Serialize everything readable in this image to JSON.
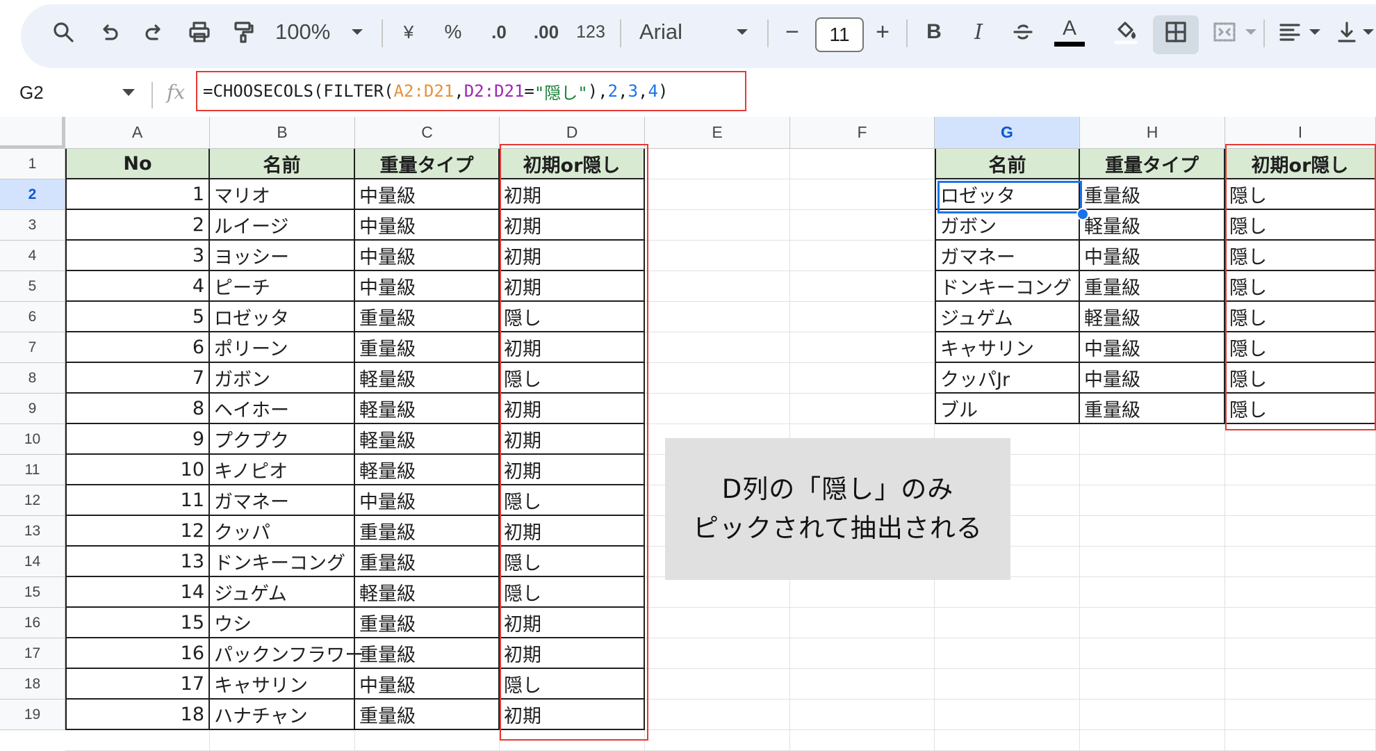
{
  "toolbar": {
    "zoom": "100%",
    "currency": "¥",
    "percent": "%",
    "decimal_decrease": ".0",
    "decimal_increase": ".00",
    "number_format": "123",
    "font_name": "Arial",
    "font_size": "11",
    "minus": "−",
    "plus": "+",
    "bold": "B",
    "italic": "I",
    "text_color": "A"
  },
  "formula_bar": {
    "cell_ref": "G2",
    "fx": "fx",
    "parts": [
      "=CHOOSECOLS(FILTER(",
      "A2:D21",
      ", ",
      "D2:D21",
      " = ",
      "\"隠し\"",
      "), ",
      "2",
      ", ",
      "3",
      ", ",
      "4",
      ")"
    ]
  },
  "columns": [
    "A",
    "B",
    "C",
    "D",
    "E",
    "F",
    "G",
    "H",
    "I"
  ],
  "rows": [
    "1",
    "2",
    "3",
    "4",
    "5",
    "6",
    "7",
    "8",
    "9",
    "10",
    "11",
    "12",
    "13",
    "14",
    "15",
    "16",
    "17",
    "18",
    "19"
  ],
  "left_table": {
    "headers": [
      "No",
      "名前",
      "重量タイプ",
      "初期or隠し"
    ],
    "rows": [
      [
        "1",
        "マリオ",
        "中量級",
        "初期"
      ],
      [
        "2",
        "ルイージ",
        "中量級",
        "初期"
      ],
      [
        "3",
        "ヨッシー",
        "中量級",
        "初期"
      ],
      [
        "4",
        "ピーチ",
        "中量級",
        "初期"
      ],
      [
        "5",
        "ロゼッタ",
        "重量級",
        "隠し"
      ],
      [
        "6",
        "ポリーン",
        "重量級",
        "初期"
      ],
      [
        "7",
        "ガボン",
        "軽量級",
        "隠し"
      ],
      [
        "8",
        "ヘイホー",
        "軽量級",
        "初期"
      ],
      [
        "9",
        "プクプク",
        "軽量級",
        "初期"
      ],
      [
        "10",
        "キノピオ",
        "軽量級",
        "初期"
      ],
      [
        "11",
        "ガマネー",
        "中量級",
        "隠し"
      ],
      [
        "12",
        "クッパ",
        "重量級",
        "初期"
      ],
      [
        "13",
        "ドンキーコング",
        "重量級",
        "隠し"
      ],
      [
        "14",
        "ジュゲム",
        "軽量級",
        "隠し"
      ],
      [
        "15",
        "ウシ",
        "重量級",
        "初期"
      ],
      [
        "16",
        "パックンフラワー",
        "重量級",
        "初期"
      ],
      [
        "17",
        "キャサリン",
        "中量級",
        "隠し"
      ],
      [
        "18",
        "ハナチャン",
        "重量級",
        "初期"
      ]
    ]
  },
  "right_table": {
    "headers": [
      "名前",
      "重量タイプ",
      "初期or隠し"
    ],
    "rows": [
      [
        "ロゼッタ",
        "重量級",
        "隠し"
      ],
      [
        "ガボン",
        "軽量級",
        "隠し"
      ],
      [
        "ガマネー",
        "中量級",
        "隠し"
      ],
      [
        "ドンキーコング",
        "重量級",
        "隠し"
      ],
      [
        "ジュゲム",
        "軽量級",
        "隠し"
      ],
      [
        "キャサリン",
        "中量級",
        "隠し"
      ],
      [
        "クッパJr",
        "中量級",
        "隠し"
      ],
      [
        "ブル",
        "重量級",
        "隠し"
      ]
    ]
  },
  "callout": {
    "line1": "D列の「隠し」のみ",
    "line2": "ピックされて抽出される"
  },
  "colors": {
    "header_fill": "#d9ead3",
    "highlight_red": "#e53935",
    "selection_blue": "#1a73e8",
    "toolbar_bg": "#edf2fa"
  }
}
